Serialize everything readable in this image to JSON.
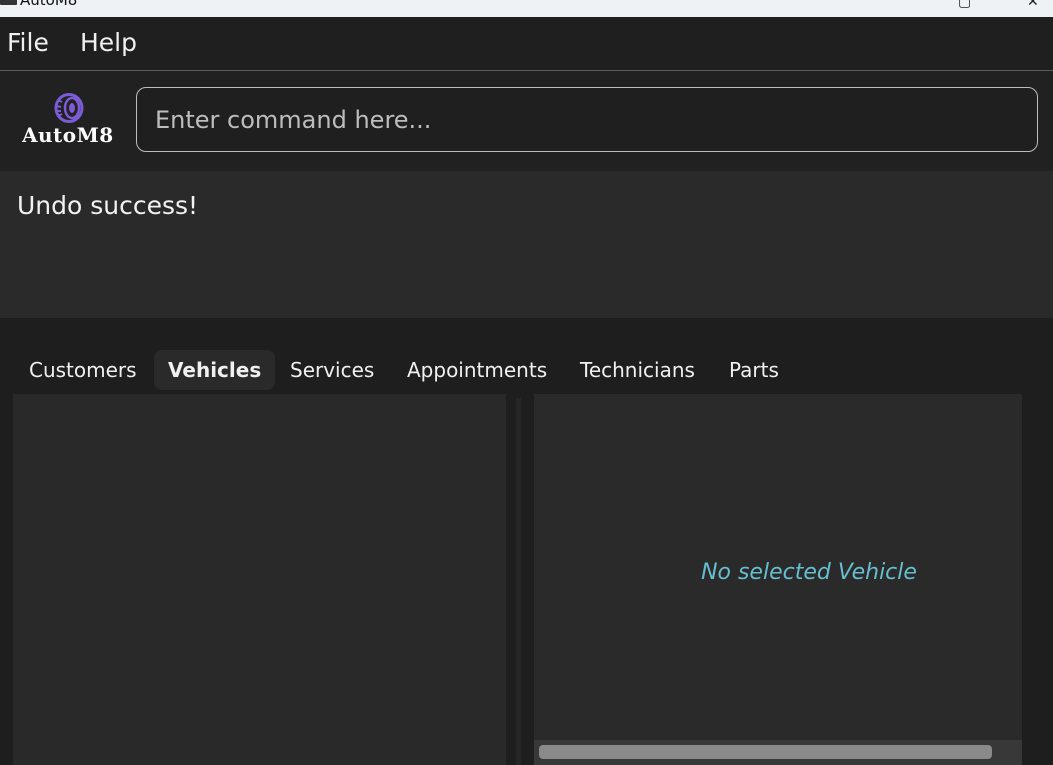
{
  "window": {
    "title": "AutoM8",
    "icon": "app-icon"
  },
  "menu": {
    "items": [
      "File",
      "Help"
    ]
  },
  "header": {
    "logo_text": "AutoM8",
    "logo_icon": "tire-icon",
    "logo_color": "#7b5cd6",
    "command_placeholder": "Enter command here..."
  },
  "result": {
    "message": "Undo success!"
  },
  "tabs": {
    "items": [
      "Customers",
      "Vehicles",
      "Services",
      "Appointments",
      "Technicians",
      "Parts"
    ],
    "active": "Vehicles"
  },
  "detail": {
    "empty_message": "No selected Vehicle",
    "empty_color": "#66bfcf"
  }
}
